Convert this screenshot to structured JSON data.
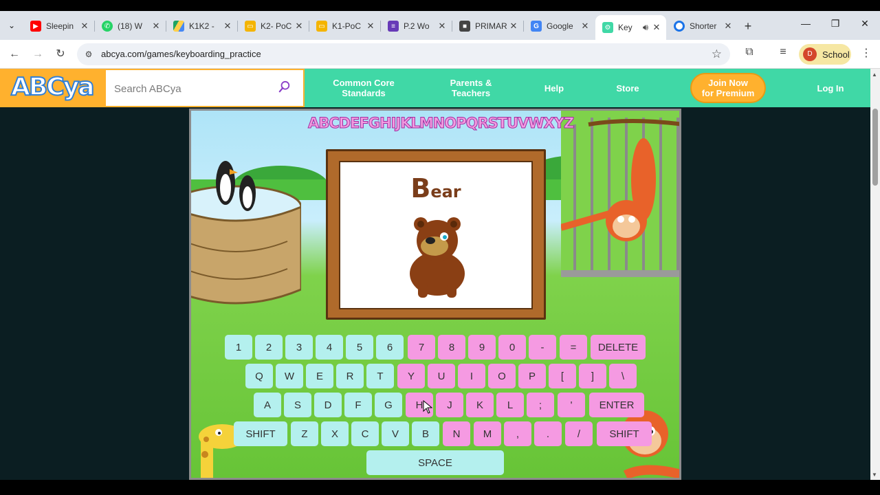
{
  "browser": {
    "tabs": [
      {
        "label": "Sleepin",
        "icon": "youtube-icon",
        "color": "#ff0000"
      },
      {
        "label": "(18) W",
        "icon": "whatsapp-icon",
        "color": "#25d366"
      },
      {
        "label": "K1K2 -",
        "icon": "drive-icon",
        "color": "#1fa463"
      },
      {
        "label": "K2- PoC",
        "icon": "slides-icon",
        "color": "#f4b400"
      },
      {
        "label": "K1-PoC",
        "icon": "slides-icon",
        "color": "#f4b400"
      },
      {
        "label": "P.2 Wo",
        "icon": "forms-icon",
        "color": "#673ab7"
      },
      {
        "label": "PRIMAR",
        "icon": "classroom-icon",
        "color": "#444444"
      },
      {
        "label": "Google",
        "icon": "translate-icon",
        "color": "#4285f4"
      },
      {
        "label": "Key",
        "icon": "abcya-icon",
        "color": "#40d8a6",
        "active": true
      },
      {
        "label": "Shorter",
        "icon": "globe-icon",
        "color": "#1a73e8"
      }
    ],
    "url": "abcya.com/games/keyboarding_practice",
    "profile_initial": "D",
    "profile_label": "School"
  },
  "site": {
    "logo": "ABCya",
    "search_placeholder": "Search ABCya",
    "nav": {
      "common_core_1": "Common Core",
      "common_core_2": "Standards",
      "parents_1": "Parents &",
      "parents_2": "Teachers",
      "help": "Help",
      "store": "Store",
      "premium_1": "Join Now",
      "premium_2": "for Premium",
      "login": "Log In"
    }
  },
  "game": {
    "alphabet": "ABCDEFGHIJKLMNOPQRSTUVWXYZ",
    "word_first": "B",
    "word_rest": "ear",
    "keys": {
      "r1": [
        "1",
        "2",
        "3",
        "4",
        "5",
        "6",
        "7",
        "8",
        "9",
        "0",
        "-",
        "=",
        "DELETE"
      ],
      "r2": [
        "Q",
        "W",
        "E",
        "R",
        "T",
        "Y",
        "U",
        "I",
        "O",
        "P",
        "[",
        "]",
        "\\"
      ],
      "r3": [
        "A",
        "S",
        "D",
        "F",
        "G",
        "H",
        "J",
        "K",
        "L",
        ";",
        "'",
        "ENTER"
      ],
      "r4": [
        "SHIFT",
        "Z",
        "X",
        "C",
        "V",
        "B",
        "N",
        "M",
        ",",
        ".",
        "/",
        "SHIFT"
      ],
      "space": "SPACE"
    },
    "colors": {
      "left_hand": "#b4f0ee",
      "right_hand": "#f59ae2"
    }
  }
}
